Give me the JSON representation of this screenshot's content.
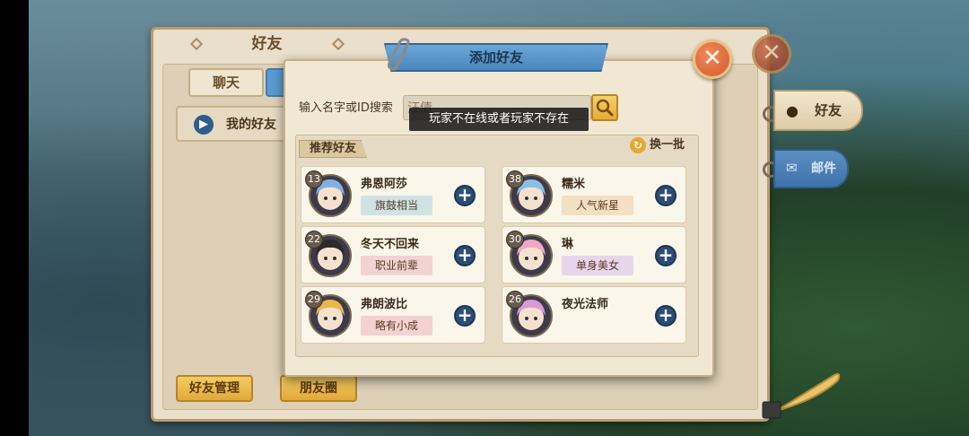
{
  "back_panel": {
    "title": "好友",
    "tab_chat": "聊天",
    "my_friends": "我的好友",
    "bottom_buttons": [
      "好友管理",
      "朋友圈"
    ],
    "side_tabs": [
      "好友",
      "邮件"
    ]
  },
  "dialog": {
    "title": "添加好友",
    "search_label": "输入名字或ID搜索",
    "search_value": "汪倩",
    "toast": "玩家不在线或者玩家不存在",
    "recommend_title": "推荐好友",
    "refresh_label": "换一批",
    "cards": [
      {
        "level": "13",
        "name": "弗恩阿莎",
        "tag": "旗鼓相当",
        "tag_color": "#cfe3e4",
        "hair": "#7fb2e0"
      },
      {
        "level": "38",
        "name": "糯米",
        "tag": "人气新星",
        "tag_color": "#f3dfc2",
        "hair": "#8cbde6"
      },
      {
        "level": "22",
        "name": "冬天不回来",
        "tag": "职业前辈",
        "tag_color": "#f3d2d2",
        "hair": "#2a2a2a"
      },
      {
        "level": "30",
        "name": "琳",
        "tag": "单身美女",
        "tag_color": "#e6d6ec",
        "hair": "#f2a6c8"
      },
      {
        "level": "29",
        "name": "弗朗波比",
        "tag": "略有小成",
        "tag_color": "#f3d2d2",
        "hair": "#e8b84a"
      },
      {
        "level": "26",
        "name": "夜光法师",
        "tag": "",
        "tag_color": "",
        "hair": "#d99ad8"
      }
    ]
  }
}
